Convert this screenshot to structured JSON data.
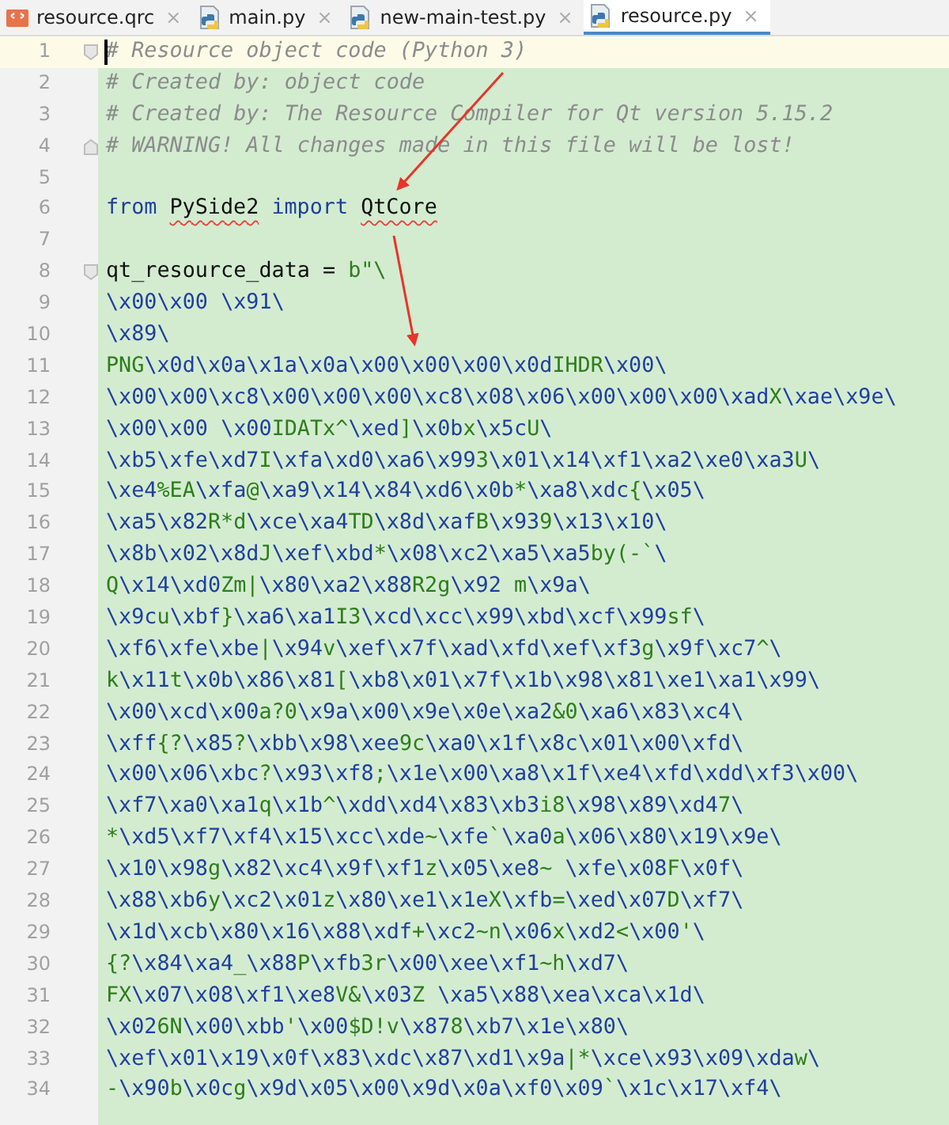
{
  "tabs": [
    {
      "label": "resource.qrc",
      "kind": "qrc",
      "selected": false,
      "close": "×"
    },
    {
      "label": "main.py",
      "kind": "python",
      "selected": false,
      "close": "×"
    },
    {
      "label": "new-main-test.py",
      "kind": "python",
      "selected": false,
      "close": "×"
    },
    {
      "label": "resource.py",
      "kind": "python",
      "selected": true,
      "close": "×"
    }
  ],
  "editor": {
    "lines": [
      {
        "number": "1",
        "kind": "comment",
        "text": "# Resource object code (Python 3)",
        "current": true,
        "fold_start": true
      },
      {
        "number": "2",
        "kind": "comment",
        "text": "# Created by: object code",
        "current": false
      },
      {
        "number": "3",
        "kind": "comment",
        "text": "# Created by: The Resource Compiler for Qt version 5.15.2",
        "current": false
      },
      {
        "number": "4",
        "kind": "comment",
        "text": "# WARNING! All changes made in this file will be lost!",
        "current": false,
        "fold_end": true
      },
      {
        "number": "5",
        "kind": "blank",
        "current": false
      },
      {
        "number": "6",
        "kind": "code",
        "current": false,
        "segments": [
          {
            "text": "from",
            "kind": "keyword"
          },
          {
            "text": "PySide2",
            "kind": "name",
            "spell_warning": true
          },
          {
            "text": "import",
            "kind": "keyword"
          },
          {
            "text": "QtCore",
            "kind": "name",
            "spell_warning": true
          }
        ]
      },
      {
        "number": "7",
        "kind": "blank",
        "current": false
      },
      {
        "number": "8",
        "kind": "code",
        "current": false,
        "fold_start": true,
        "segments": [
          {
            "text": "qt_resource_data",
            "kind": "name"
          },
          {
            "text": "=",
            "kind": "operator"
          },
          {
            "text": "b\"\\",
            "kind": "string"
          }
        ]
      },
      {
        "number": "9",
        "kind": "bytes",
        "text": "\\x00\\x00 \\x91\\",
        "current": false
      },
      {
        "number": "10",
        "kind": "bytes",
        "text": "\\x89\\",
        "current": false
      },
      {
        "number": "11",
        "kind": "bytes",
        "text": "PNG\\x0d\\x0a\\x1a\\x0a\\x00\\x00\\x00\\x0dIHDR\\x00\\",
        "current": false
      },
      {
        "number": "12",
        "kind": "bytes",
        "text": "\\x00\\x00\\xc8\\x00\\x00\\x00\\xc8\\x08\\x06\\x00\\x00\\x00\\xadX\\xae\\x9e\\",
        "current": false
      },
      {
        "number": "13",
        "kind": "bytes",
        "text": "\\x00\\x00 \\x00IDATx^\\xed]\\x0bx\\x5cU\\",
        "current": false
      },
      {
        "number": "14",
        "kind": "bytes",
        "text": "\\xb5\\xfe\\xd7I\\xfa\\xd0\\xa6\\x993\\x01\\x14\\xf1\\xa2\\xe0\\xa3U\\",
        "current": false
      },
      {
        "number": "15",
        "kind": "bytes",
        "text": "\\xe4%EA\\xfa@\\xa9\\x14\\x84\\xd6\\x0b*\\xa8\\xdc{\\x05\\",
        "current": false
      },
      {
        "number": "16",
        "kind": "bytes",
        "text": "\\xa5\\x82R*d\\xce\\xa4TD\\x8d\\xafB\\x939\\x13\\x10\\",
        "current": false
      },
      {
        "number": "17",
        "kind": "bytes",
        "text": "\\x8b\\x02\\x8dJ\\xef\\xbd*\\x08\\xc2\\xa5\\xa5by(-`\\",
        "current": false
      },
      {
        "number": "18",
        "kind": "bytes",
        "text": "Q\\x14\\xd0Zm|\\x80\\xa2\\x88R2g\\x92 m\\x9a\\",
        "current": false
      },
      {
        "number": "19",
        "kind": "bytes",
        "text": "\\x9cu\\xbf}\\xa6\\xa1I3\\xcd\\xcc\\x99\\xbd\\xcf\\x99sf\\",
        "current": false
      },
      {
        "number": "20",
        "kind": "bytes",
        "text": "\\xf6\\xfe\\xbe|\\x94v\\xef\\x7f\\xad\\xfd\\xef\\xf3g\\x9f\\xc7^\\",
        "current": false
      },
      {
        "number": "21",
        "kind": "bytes",
        "text": "k\\x11t\\x0b\\x86\\x81[\\xb8\\x01\\x7f\\x1b\\x98\\x81\\xe1\\xa1\\x99\\",
        "current": false
      },
      {
        "number": "22",
        "kind": "bytes",
        "text": "\\x00\\xcd\\x00a?0\\x9a\\x00\\x9e\\x0e\\xa2&0\\xa6\\x83\\xc4\\",
        "current": false
      },
      {
        "number": "23",
        "kind": "bytes",
        "text": "\\xff{?\\x85?\\xbb\\x98\\xee9c\\xa0\\x1f\\x8c\\x01\\x00\\xfd\\",
        "current": false
      },
      {
        "number": "24",
        "kind": "bytes",
        "text": "\\x00\\x06\\xbc?\\x93\\xf8;\\x1e\\x00\\xa8\\x1f\\xe4\\xfd\\xdd\\xf3\\x00\\",
        "current": false
      },
      {
        "number": "25",
        "kind": "bytes",
        "text": "\\xf7\\xa0\\xa1q\\x1b^\\xdd\\xd4\\x83\\xb3i8\\x98\\x89\\xd47\\",
        "current": false
      },
      {
        "number": "26",
        "kind": "bytes",
        "text": "*\\xd5\\xf7\\xf4\\x15\\xcc\\xde~\\xfe`\\xa0a\\x06\\x80\\x19\\x9e\\",
        "current": false
      },
      {
        "number": "27",
        "kind": "bytes",
        "text": "\\x10\\x98g\\x82\\xc4\\x9f\\xf1z\\x05\\xe8~ \\xfe\\x08F\\x0f\\",
        "current": false
      },
      {
        "number": "28",
        "kind": "bytes",
        "text": "\\x88\\xb6y\\xc2\\x01z\\x80\\xe1\\x1eX\\xfb=\\xed\\x07D\\xf7\\",
        "current": false
      },
      {
        "number": "29",
        "kind": "bytes",
        "text": "\\x1d\\xcb\\x80\\x16\\x88\\xdf+\\xc2~n\\x06x\\xd2<\\x00'\\",
        "current": false
      },
      {
        "number": "30",
        "kind": "bytes",
        "text": "{?\\x84\\xa4_\\x88P\\xfb3r\\x00\\xee\\xf1~h\\xd7\\",
        "current": false
      },
      {
        "number": "31",
        "kind": "bytes",
        "text": "FX\\x07\\x08\\xf1\\xe8V&\\x03Z \\xa5\\x88\\xea\\xca\\x1d\\",
        "current": false
      },
      {
        "number": "32",
        "kind": "bytes",
        "text": "\\x026N\\x00\\xbb'\\x00$D!v\\x878\\xb7\\x1e\\x80\\",
        "current": false
      },
      {
        "number": "33",
        "kind": "bytes",
        "text": "\\xef\\x01\\x19\\x0f\\x83\\xdc\\x87\\xd1\\x9a|*\\xce\\x93\\x09\\xdaw\\",
        "current": false
      },
      {
        "number": "34",
        "kind": "bytes",
        "text": "-\\x90b\\x0cg\\x9d\\x05\\x00\\x9d\\x0a\\xf0\\x09`\\x1c\\x17\\xf4\\",
        "current": false
      }
    ]
  }
}
